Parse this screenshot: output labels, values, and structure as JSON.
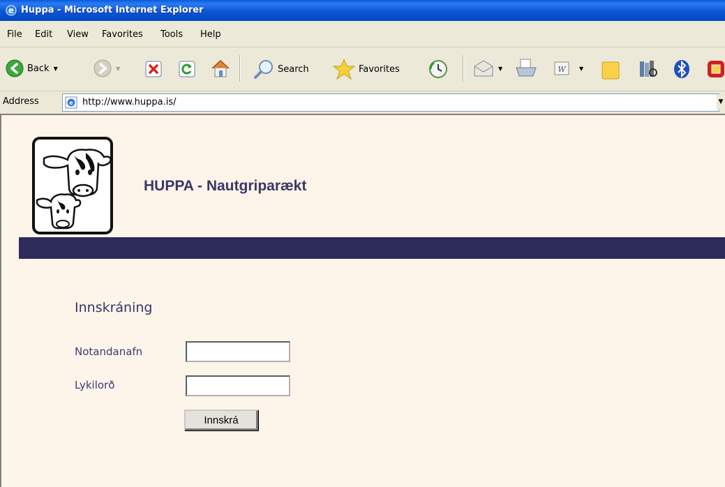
{
  "window": {
    "title": "Huppa - Microsoft Internet Explorer"
  },
  "menu": [
    "File",
    "Edit",
    "View",
    "Favorites",
    "Tools",
    "Help"
  ],
  "toolbar": {
    "back_label": "Back",
    "search_label": "Search",
    "favorites_label": "Favorites"
  },
  "address": {
    "label": "Address",
    "url": "http://www.huppa.is/"
  },
  "page": {
    "site_title": "HUPPA - Nautgriparækt",
    "login_heading": "Innskráning",
    "username_label": "Notandanafn",
    "password_label": "Lykilorð",
    "username_value": "",
    "password_value": "",
    "submit_label": "Innskrá"
  },
  "colors": {
    "banner": "#2e2c5b",
    "heading": "#35346a",
    "page_bg": "#fdf5ea"
  }
}
